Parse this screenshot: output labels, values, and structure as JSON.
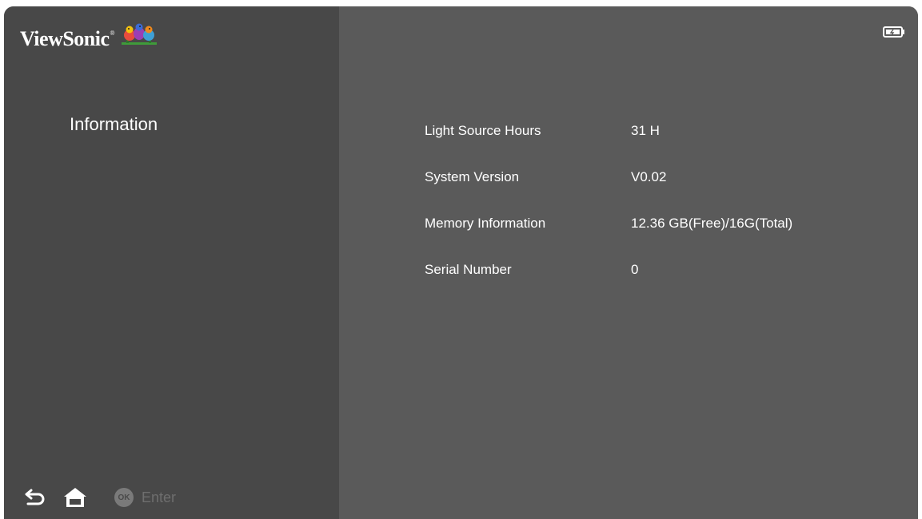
{
  "brand": {
    "name": "ViewSonic",
    "reg": "®"
  },
  "sidebar": {
    "menu_item": "Information",
    "footer": {
      "ok_badge": "OK",
      "enter_label": "Enter"
    }
  },
  "info": {
    "rows": [
      {
        "label": "Light Source Hours",
        "value": "31 H"
      },
      {
        "label": "System Version",
        "value": "V0.02"
      },
      {
        "label": "Memory Information",
        "value": "12.36 GB(Free)/16G(Total)"
      },
      {
        "label": "Serial Number",
        "value": "0"
      }
    ]
  },
  "icons": {
    "back": "back-arrow-icon",
    "home": "home-icon",
    "battery": "battery-icon",
    "logo": "viewsonic-birds-logo"
  },
  "colors": {
    "sidebar_bg": "#484848",
    "main_bg": "#5a5a5a",
    "text": "#ffffff",
    "muted": "#6e6e6e"
  }
}
